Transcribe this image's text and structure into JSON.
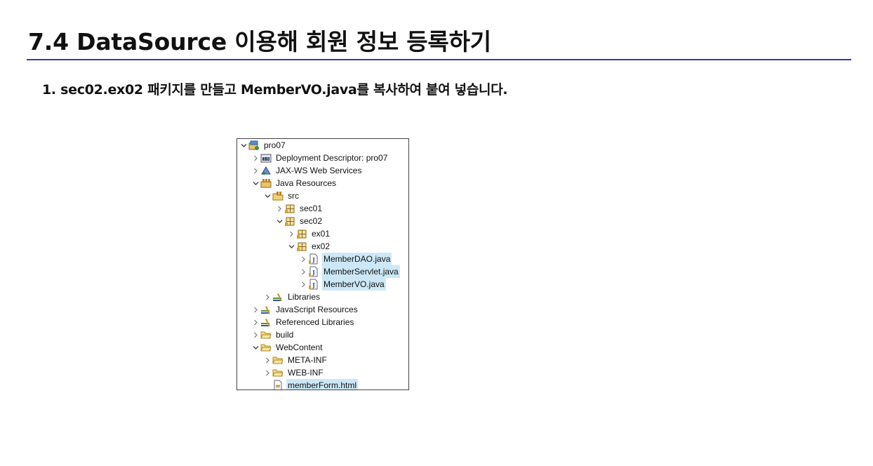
{
  "slide": {
    "title": "7.4 DataSource 이용해 회원 정보 등록하기",
    "step": "1. sec02.ex02 패키지를 만들고 MemberVO.java를 복사하여 붙여 넣습니다."
  },
  "tree": {
    "items": [
      {
        "label": "pro07",
        "icon": "project-icon",
        "level": 0,
        "state": "expanded",
        "selected": false
      },
      {
        "label": "Deployment Descriptor: pro07",
        "icon": "deployment-descriptor-icon",
        "level": 1,
        "state": "collapsed",
        "selected": false
      },
      {
        "label": "JAX-WS Web Services",
        "icon": "web-services-icon",
        "level": 1,
        "state": "collapsed",
        "selected": false
      },
      {
        "label": "Java Resources",
        "icon": "java-resources-icon",
        "level": 1,
        "state": "expanded",
        "selected": false
      },
      {
        "label": "src",
        "icon": "source-folder-icon",
        "level": 2,
        "state": "expanded",
        "selected": false
      },
      {
        "label": "sec01",
        "icon": "package-icon",
        "level": 3,
        "state": "collapsed",
        "selected": false
      },
      {
        "label": "sec02",
        "icon": "package-icon",
        "level": 3,
        "state": "expanded",
        "selected": false
      },
      {
        "label": "ex01",
        "icon": "package-icon",
        "level": 4,
        "state": "collapsed",
        "selected": false
      },
      {
        "label": "ex02",
        "icon": "package-icon",
        "level": 4,
        "state": "expanded",
        "selected": false
      },
      {
        "label": "MemberDAO.java",
        "icon": "java-file-icon",
        "level": 5,
        "state": "collapsed",
        "selected": true
      },
      {
        "label": "MemberServlet.java",
        "icon": "java-file-icon",
        "level": 5,
        "state": "collapsed",
        "selected": true
      },
      {
        "label": "MemberVO.java",
        "icon": "java-file-icon",
        "level": 5,
        "state": "collapsed",
        "selected": true
      },
      {
        "label": "Libraries",
        "icon": "library-icon",
        "level": 2,
        "state": "collapsed",
        "selected": false
      },
      {
        "label": "JavaScript Resources",
        "icon": "library-icon",
        "level": 1,
        "state": "collapsed",
        "selected": false
      },
      {
        "label": "Referenced Libraries",
        "icon": "library-icon",
        "level": 1,
        "state": "collapsed",
        "selected": false
      },
      {
        "label": "build",
        "icon": "folder-icon",
        "level": 1,
        "state": "collapsed",
        "selected": false
      },
      {
        "label": "WebContent",
        "icon": "folder-icon",
        "level": 1,
        "state": "expanded",
        "selected": false
      },
      {
        "label": "META-INF",
        "icon": "folder-icon",
        "level": 2,
        "state": "collapsed",
        "selected": false
      },
      {
        "label": "WEB-INF",
        "icon": "folder-icon",
        "level": 2,
        "state": "collapsed",
        "selected": false
      },
      {
        "label": "memberForm.html",
        "icon": "html-file-icon",
        "level": 2,
        "state": "leaf",
        "selected": true
      }
    ]
  }
}
